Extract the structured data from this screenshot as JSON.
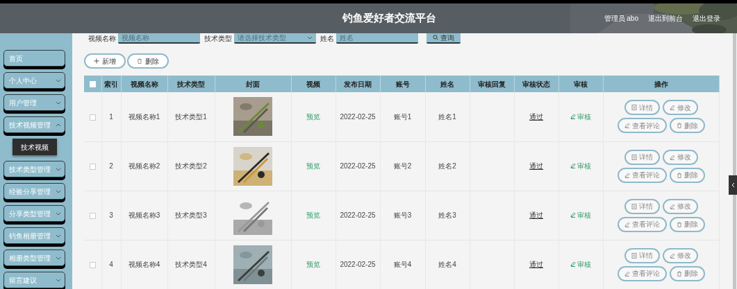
{
  "header": {
    "title": "钓鱼爱好者交流平台",
    "user": "管理员 abo",
    "links": [
      "退出到前台",
      "退出登录"
    ]
  },
  "sidebar": {
    "items": [
      {
        "kind": "link",
        "label": "首页"
      },
      {
        "kind": "menu",
        "label": "个人中心",
        "expanded": false
      },
      {
        "kind": "menu",
        "label": "用户管理",
        "expanded": false
      },
      {
        "kind": "menu",
        "label": "技术视频管理",
        "expanded": true,
        "children": [
          {
            "label": "技术视频"
          }
        ]
      },
      {
        "kind": "menu",
        "label": "技术类型管理",
        "expanded": false
      },
      {
        "kind": "menu",
        "label": "经验分享管理",
        "expanded": false
      },
      {
        "kind": "menu",
        "label": "分享类型管理",
        "expanded": false
      },
      {
        "kind": "menu",
        "label": "钓鱼相册管理",
        "expanded": false
      },
      {
        "kind": "menu",
        "label": "相册类型管理",
        "expanded": false
      },
      {
        "kind": "menu",
        "label": "留言建议",
        "expanded": false
      }
    ]
  },
  "search": {
    "fields": [
      {
        "label": "视频名称",
        "placeholder": "视频名称",
        "kind": "text"
      },
      {
        "label": "技术类型",
        "placeholder": "请选择技术类型",
        "kind": "select"
      },
      {
        "label": "姓名",
        "placeholder": "姓名",
        "kind": "text"
      }
    ],
    "button": "查询"
  },
  "toolbar": [
    "新增",
    "删除"
  ],
  "table": {
    "all_checked": false,
    "columns": [
      "索引",
      "视频名称",
      "技术类型",
      "封面",
      "视频",
      "发布日期",
      "账号",
      "姓名",
      "审核回复",
      "审核状态",
      "审核",
      "操作"
    ],
    "rows": [
      {
        "checked": false,
        "index": "1",
        "name": "视频名称1",
        "type": "技术类型1",
        "video": "预览",
        "date": "2022-02-25",
        "account": "账号1",
        "person": "姓名1",
        "status": "通过",
        "review": "审核",
        "actions": [
          "详情",
          "修改",
          "查看评论",
          "删除"
        ]
      },
      {
        "checked": false,
        "index": "2",
        "name": "视频名称2",
        "type": "技术类型2",
        "video": "预览",
        "date": "2022-02-25",
        "account": "账号2",
        "person": "姓名2",
        "status": "通过",
        "review": "审核",
        "actions": [
          "详情",
          "修改",
          "查看评论",
          "删除"
        ]
      },
      {
        "checked": false,
        "index": "3",
        "name": "视频名称3",
        "type": "技术类型3",
        "video": "预览",
        "date": "2022-02-25",
        "account": "账号3",
        "person": "姓名3",
        "status": "通过",
        "review": "审核",
        "actions": [
          "详情",
          "修改",
          "查看评论",
          "删除"
        ]
      },
      {
        "checked": false,
        "index": "4",
        "name": "视频名称4",
        "type": "技术类型4",
        "video": "预览",
        "date": "2022-02-25",
        "account": "账号4",
        "person": "姓名4",
        "status": "通过",
        "review": "审核",
        "actions": [
          "详情",
          "修改",
          "查看评论",
          "删除"
        ]
      }
    ]
  }
}
